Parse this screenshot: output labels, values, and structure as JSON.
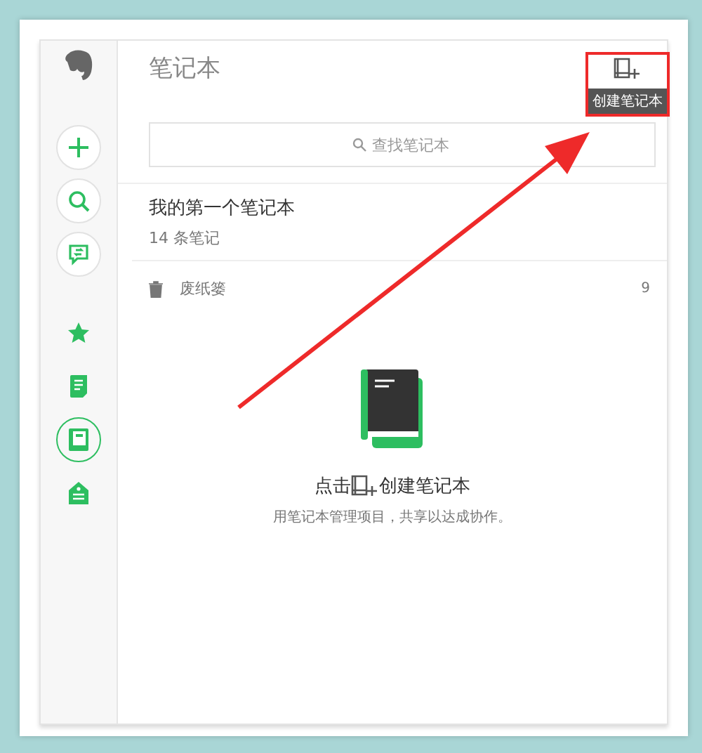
{
  "sidebar": {
    "items": [
      {
        "kind": "new",
        "selected": false
      },
      {
        "kind": "search",
        "selected": false
      },
      {
        "kind": "share",
        "selected": false
      },
      {
        "kind": "shortcuts",
        "selected": false
      },
      {
        "kind": "notes",
        "selected": false
      },
      {
        "kind": "notebooks",
        "selected": true
      },
      {
        "kind": "tags",
        "selected": false
      }
    ]
  },
  "header": {
    "title": "笔记本",
    "create_tooltip": "创建笔记本"
  },
  "search": {
    "placeholder": "查找笔记本"
  },
  "notebooks": [
    {
      "name": "我的第一个笔记本",
      "count": "14 条笔记"
    }
  ],
  "trash": {
    "label": "废纸篓",
    "count": "9"
  },
  "empty_state": {
    "before_icon": "点击",
    "after_icon": "创建笔记本",
    "hint": "用笔记本管理项目，共享以达成协作。"
  }
}
